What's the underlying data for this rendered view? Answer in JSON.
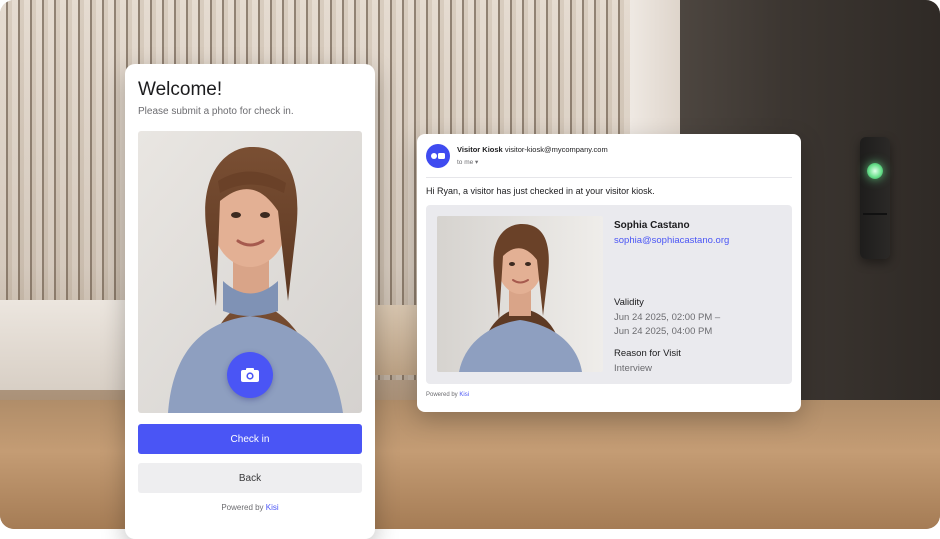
{
  "kiosk": {
    "title": "Welcome!",
    "subtitle": "Please submit a photo for check in.",
    "checkin_label": "Check in",
    "back_label": "Back",
    "powered_prefix": "Powered by ",
    "powered_brand": "Kisi"
  },
  "email": {
    "sender_name": "Visitor Kiosk",
    "sender_address": "visitor-kiosk@mycompany.com",
    "to_line": "to me ▾",
    "greeting": "Hi Ryan, a visitor has just checked in at your visitor kiosk.",
    "visitor_name": "Sophia Castano",
    "visitor_email": "sophia@sophiacastano.org",
    "validity_label": "Validity",
    "validity_start": "Jun 24 2025, 02:00 PM  –",
    "validity_end": "Jun 24 2025, 04:00 PM",
    "reason_label": "Reason for Visit",
    "reason_value": "Interview",
    "powered_prefix": "Powered by ",
    "powered_brand": "Kisi"
  },
  "colors": {
    "accent": "#4a55f5",
    "reader_light": "#69e08c"
  },
  "icons": {
    "camera": "camera-icon",
    "avatar": "kisi-logo-icon",
    "reader": "door-reader-icon"
  }
}
